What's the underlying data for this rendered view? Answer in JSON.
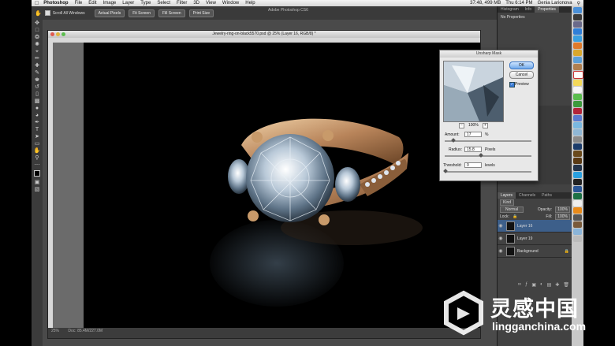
{
  "menubar": {
    "app": "Photoshop",
    "items": [
      "File",
      "Edit",
      "Image",
      "Layer",
      "Type",
      "Select",
      "Filter",
      "3D",
      "View",
      "Window",
      "Help"
    ],
    "status": "37:48, 499 MB",
    "clock": "Thu 6:14 PM",
    "user": "Genia Larionova"
  },
  "optionsbar": {
    "scroll_all": "Scroll All Windows",
    "buttons": [
      "Actual Pixels",
      "Fit Screen",
      "Fill Screen",
      "Print Size"
    ],
    "app_title": "Adobe Photoshop CS6"
  },
  "document": {
    "title": "Jewelry-ring-on-black5570.psd @ 25% (Layer 16, RGB/8) *",
    "zoom": "25%",
    "doc_info": "Doc: 85.4M/227.0M"
  },
  "panels": {
    "top_tabs": [
      "Histogram",
      "Info",
      "Properties"
    ],
    "no_properties": "No Properties",
    "layers_tabs": [
      "Layers",
      "Channels",
      "Paths"
    ],
    "kind": "Kind",
    "blend": "Normal",
    "opacity_label": "Opacity:",
    "opacity": "100%",
    "lock_label": "Lock:",
    "fill_label": "Fill:",
    "fill": "100%",
    "layers": [
      "Layer 16",
      "Layer 19",
      "Background"
    ]
  },
  "dialog": {
    "title": "Unsharp Mask",
    "ok": "OK",
    "cancel": "Cancel",
    "preview": "Preview",
    "zoom": "100%",
    "amount_label": "Amount:",
    "amount": "17",
    "amount_unit": "%",
    "radius_label": "Radius:",
    "radius": "15.8",
    "radius_unit": "Pixels",
    "threshold_label": "Threshold:",
    "threshold": "0",
    "threshold_unit": "levels"
  },
  "watermark": {
    "cn": "灵感中国",
    "url": "lingganchina.com"
  },
  "colors": {
    "ring_gold": "#c89a6a",
    "dialog_bg": "#e8e8e8",
    "selected_layer": "#3d5f8a",
    "watermark": "#ffffff"
  }
}
